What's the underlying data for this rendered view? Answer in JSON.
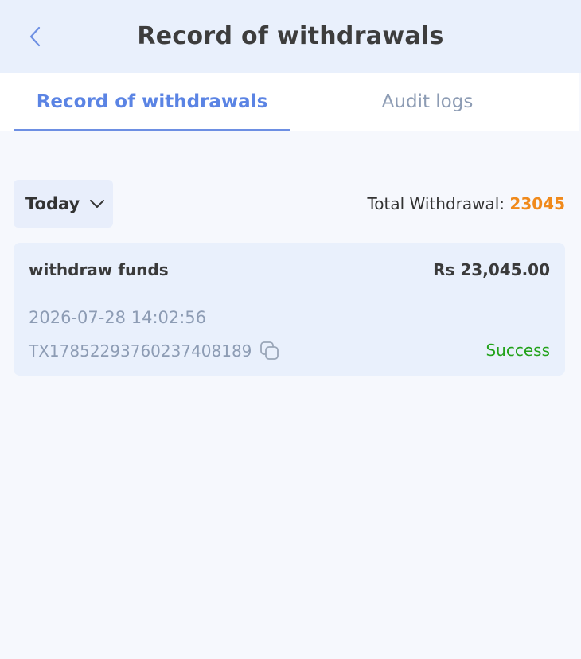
{
  "header": {
    "title": "Record of withdrawals",
    "back_icon": "chevron-left-icon"
  },
  "tabs": [
    {
      "label": "Record of withdrawals",
      "active": true
    },
    {
      "label": "Audit logs",
      "active": false
    }
  ],
  "filter": {
    "label": "Today",
    "icon": "chevron-down-icon"
  },
  "summary": {
    "label": "Total Withdrawal:",
    "value": "23045"
  },
  "records": [
    {
      "title": "withdraw funds",
      "amount": "Rs 23,045.00",
      "datetime": "2026-07-28 14:02:56",
      "txid": "TX17852293760237408189",
      "status": "Success"
    }
  ],
  "colors": {
    "accent": "#5b84e4",
    "total_value": "#f08a1c",
    "success": "#22a21a",
    "muted": "#8d9cb4"
  }
}
